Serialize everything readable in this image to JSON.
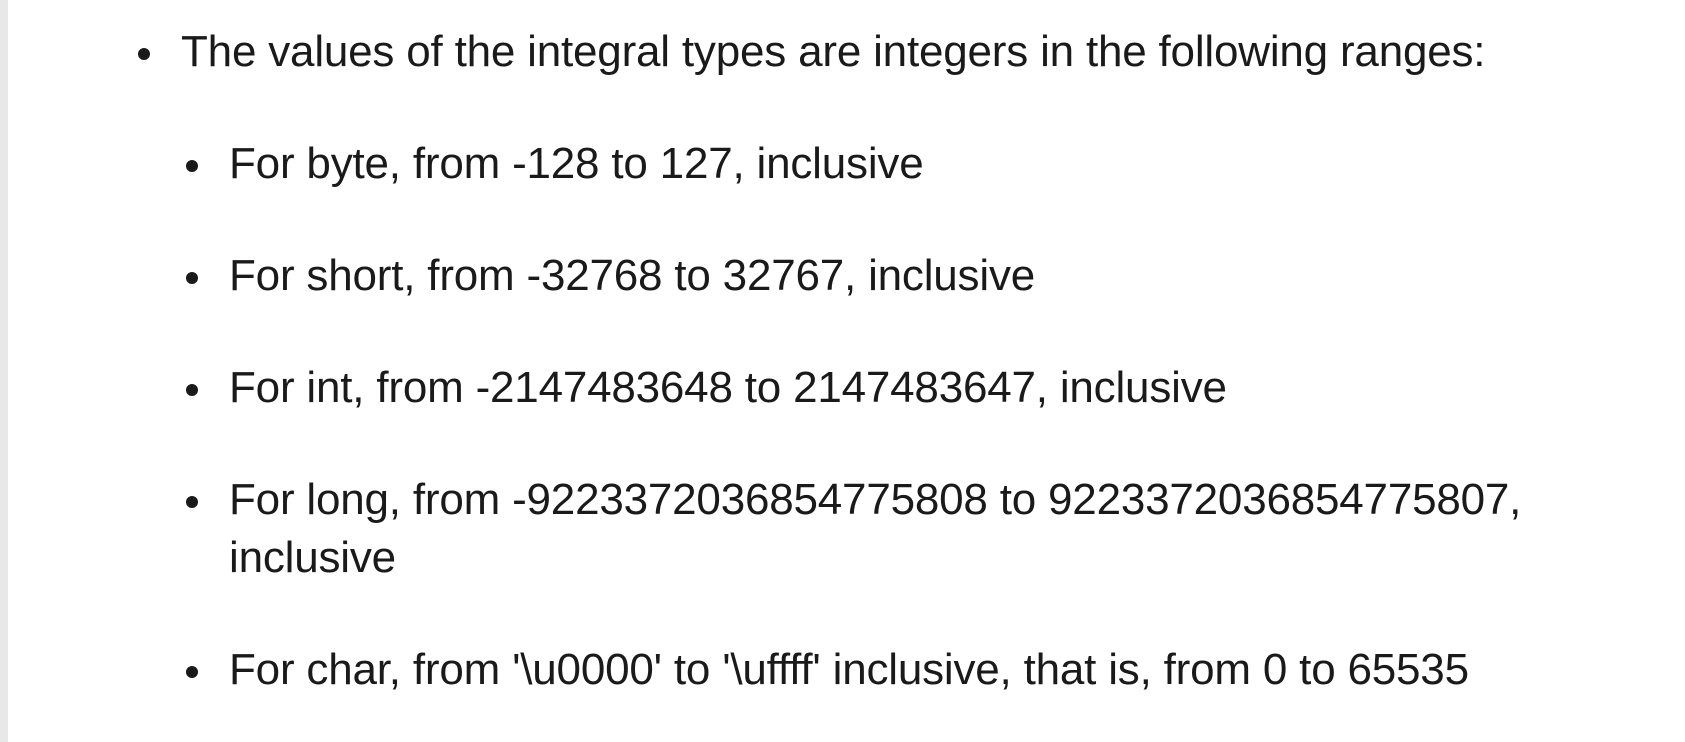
{
  "main_bullet": {
    "text": "The values of the integral types are integers in the following ranges:"
  },
  "sub_bullets": [
    {
      "text": "For byte, from -128 to 127, inclusive"
    },
    {
      "text": "For short, from -32768 to 32767, inclusive"
    },
    {
      "text": "For int, from -2147483648 to 2147483647, inclusive"
    },
    {
      "text": "For long, from -9223372036854775808 to 9223372036854775807, inclusive"
    },
    {
      "text": "For char, from '\\u0000' to '\\uffff' inclusive, that is, from 0 to 65535"
    }
  ]
}
